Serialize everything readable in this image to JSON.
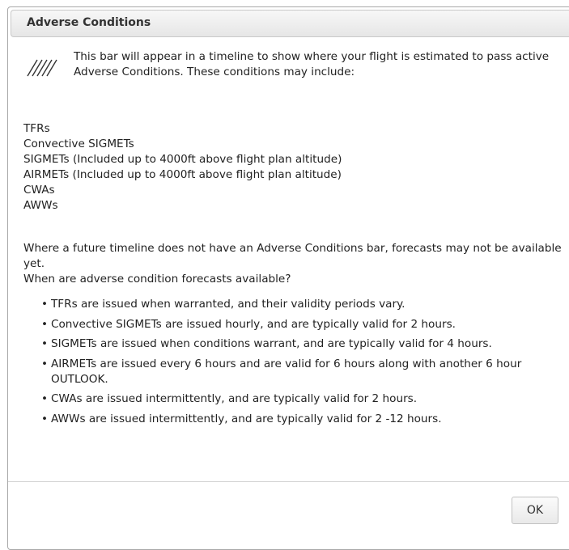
{
  "dialog": {
    "title": "Adverse Conditions",
    "intro_icon": "hatched-bar-icon",
    "intro_text": "This bar will appear in a timeline to show where your flight is estimated to pass active Adverse Conditions. These conditions may include:",
    "conditions": [
      "TFRs",
      "Convective SIGMETs",
      "SIGMETs (Included up to 4000ft above flight plan altitude)",
      "AIRMETs (Included up to 4000ft above flight plan altitude)",
      "CWAs",
      "AWWs"
    ],
    "bullets": [
      "Where a future timeline does not have an Adverse Conditions bar, forecasts may not be available yet.",
      "When are adverse condition forecasts available?"
    ],
    "forecast_details": [
      "TFRs are issued when warranted, and their validity periods vary.",
      "Convective SIGMETs are issued hourly, and are typically valid for 2 hours.",
      "SIGMETs are issued when conditions warrant, and are typically valid for 4 hours.",
      "AIRMETs are issued every 6 hours and are valid for 6 hours along with another 6 hour OUTLOOK.",
      "CWAs are issued intermittently, and are typically valid for 2 hours.",
      "AWWs are issued intermittently, and are typically valid for 2 -12 hours."
    ],
    "ok_label": "OK"
  }
}
